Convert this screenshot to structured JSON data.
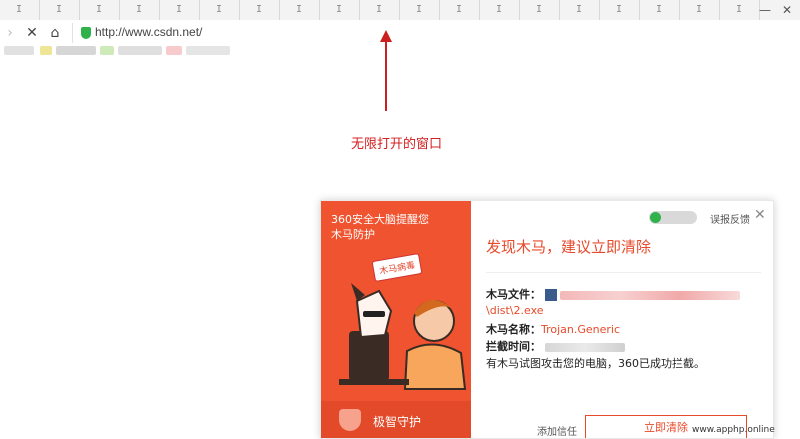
{
  "browser": {
    "tab_icons": [
      "I",
      "I",
      "I",
      "I",
      "I",
      "I",
      "I",
      "I",
      "I",
      "I",
      "I",
      "I",
      "I",
      "I",
      "I",
      "I",
      "I",
      "I",
      "I"
    ],
    "window_controls": [
      "—",
      "✕"
    ],
    "url": "http://www.csdn.net/"
  },
  "annotation": {
    "text": "无限打开的窗口",
    "color": "#d32020"
  },
  "popup": {
    "brand_line1": "360安全大脑提醒您",
    "brand_line2": "木马防护",
    "bubble_text": "木马病毒",
    "guard_label": "极智守护",
    "feedback": "误报反馈",
    "close_symbol": "✕",
    "title": "发现木马，建议立即清除",
    "file_label": "木马文件：",
    "file_path_suffix": "\\dist\\2.exe",
    "name_label": "木马名称：",
    "name_value": "Trojan.Generic",
    "time_label": "拦截时间：",
    "message": "有木马试图攻击您的电脑，360已成功拦截。",
    "trust_label": "添加信任",
    "clean_label": "立即清除",
    "accent": "#e84a2a"
  },
  "watermark": "www.apphp.online"
}
